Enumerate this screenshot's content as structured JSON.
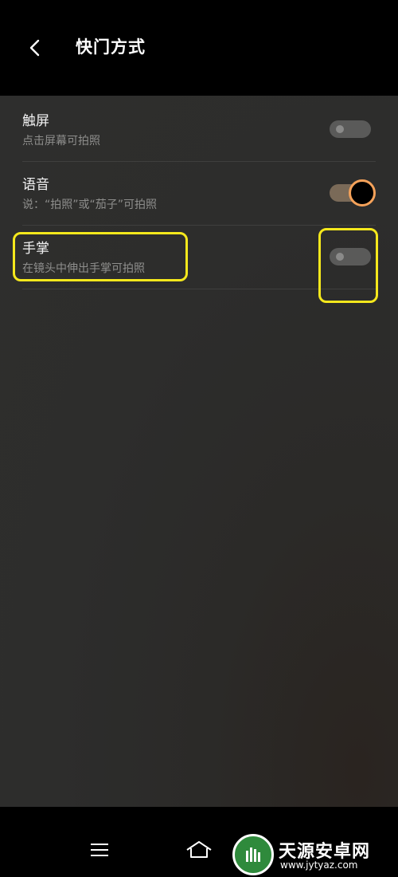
{
  "header": {
    "title": "快门方式",
    "back_icon": "chevron-left-icon"
  },
  "settings": {
    "items": [
      {
        "key": "touch",
        "title": "触屏",
        "description": "点击屏幕可拍照",
        "toggle_on": false
      },
      {
        "key": "voice",
        "title": "语音",
        "description": "说：“拍照”或“茄子”可拍照",
        "toggle_on": true
      },
      {
        "key": "palm",
        "title": "手掌",
        "description": "在镜头中伸出手掌可拍照",
        "toggle_on": false
      }
    ]
  },
  "colors": {
    "background": "#2e2e2d",
    "toggle_on_accent": "#f5a25a",
    "highlight": "#f5e81c"
  },
  "navbar": {
    "icons": [
      "menu-icon",
      "home-icon"
    ]
  },
  "watermark": {
    "name": "天源安卓网",
    "url": "www.jytyaz.com"
  }
}
